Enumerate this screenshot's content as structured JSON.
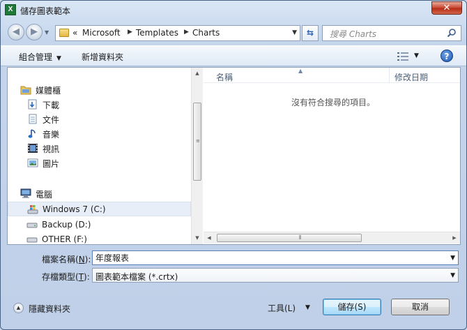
{
  "window": {
    "title": "儲存圖表範本",
    "app_icon": "X",
    "close_label": "✕"
  },
  "address": {
    "recent_marker": "«",
    "crumbs": [
      "Microsoft",
      "Templates",
      "Charts"
    ]
  },
  "search": {
    "placeholder": "搜尋 Charts"
  },
  "toolbar": {
    "organize": "組合管理",
    "new_folder": "新增資料夾",
    "help": "?"
  },
  "nav": {
    "favorites": "媒體櫃",
    "libraries": [
      "下載",
      "文件",
      "音樂",
      "視訊",
      "圖片"
    ],
    "computer": "電腦",
    "drives": [
      "Windows 7 (C:)",
      "Backup (D:)",
      "OTHER (F:)"
    ]
  },
  "file_list": {
    "col_name": "名稱",
    "col_date": "修改日期",
    "empty_message": "沒有符合搜尋的項目。"
  },
  "form": {
    "filename_label": "檔案名稱(",
    "filename_key": "N",
    "filename_suffix": "):",
    "filename_value": "年度報表",
    "filetype_label": "存檔類型(",
    "filetype_key": "T",
    "filetype_suffix": "):",
    "filetype_value": "圖表範本檔案 (*.crtx)"
  },
  "footer": {
    "hide_folders": "隱藏資料夾",
    "tools": "工具(L)",
    "save": "儲存(S)",
    "cancel": "取消"
  },
  "colors": {
    "accent": "#2f63b7",
    "close": "#c7452d",
    "excel": "#1f7a3a"
  }
}
